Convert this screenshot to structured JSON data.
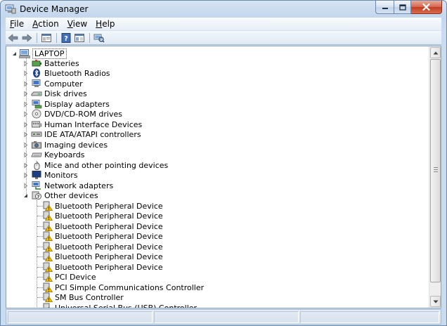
{
  "window": {
    "title": "Device Manager",
    "accent": "#c3d6ec",
    "close_color": "#c23d22"
  },
  "menu": [
    {
      "key": "F",
      "rest": "ile"
    },
    {
      "key": "A",
      "rest": "ction"
    },
    {
      "key": "V",
      "rest": "iew"
    },
    {
      "key": "H",
      "rest": "elp"
    }
  ],
  "toolbar": {
    "icons": [
      "back-arrow-icon",
      "forward-arrow-icon",
      "properties-icon",
      "help-icon",
      "show-hide-pane-icon",
      "scan-hardware-icon"
    ]
  },
  "tree": {
    "root": "LAPTOP",
    "categories": [
      {
        "label": "Batteries",
        "icon": "battery-icon"
      },
      {
        "label": "Bluetooth Radios",
        "icon": "bluetooth-icon"
      },
      {
        "label": "Computer",
        "icon": "computer-icon"
      },
      {
        "label": "Disk drives",
        "icon": "disk-drive-icon"
      },
      {
        "label": "Display adapters",
        "icon": "display-adapter-icon"
      },
      {
        "label": "DVD/CD-ROM drives",
        "icon": "dvd-drive-icon"
      },
      {
        "label": "Human Interface Devices",
        "icon": "hid-icon"
      },
      {
        "label": "IDE ATA/ATAPI controllers",
        "icon": "ide-controller-icon"
      },
      {
        "label": "Imaging devices",
        "icon": "camera-icon"
      },
      {
        "label": "Keyboards",
        "icon": "keyboard-icon"
      },
      {
        "label": "Mice and other pointing devices",
        "icon": "mouse-icon"
      },
      {
        "label": "Monitors",
        "icon": "monitor-icon"
      },
      {
        "label": "Network adapters",
        "icon": "network-adapter-icon"
      },
      {
        "label": "Other devices",
        "icon": "unknown-device-icon",
        "expanded": true
      }
    ],
    "other_devices": [
      "Bluetooth Peripheral Device",
      "Bluetooth Peripheral Device",
      "Bluetooth Peripheral Device",
      "Bluetooth Peripheral Device",
      "Bluetooth Peripheral Device",
      "Bluetooth Peripheral Device",
      "Bluetooth Peripheral Device",
      "PCI Device",
      "PCI Simple Communications Controller",
      "SM Bus Controller",
      "Universal Serial Bus (USB) Controller"
    ]
  }
}
